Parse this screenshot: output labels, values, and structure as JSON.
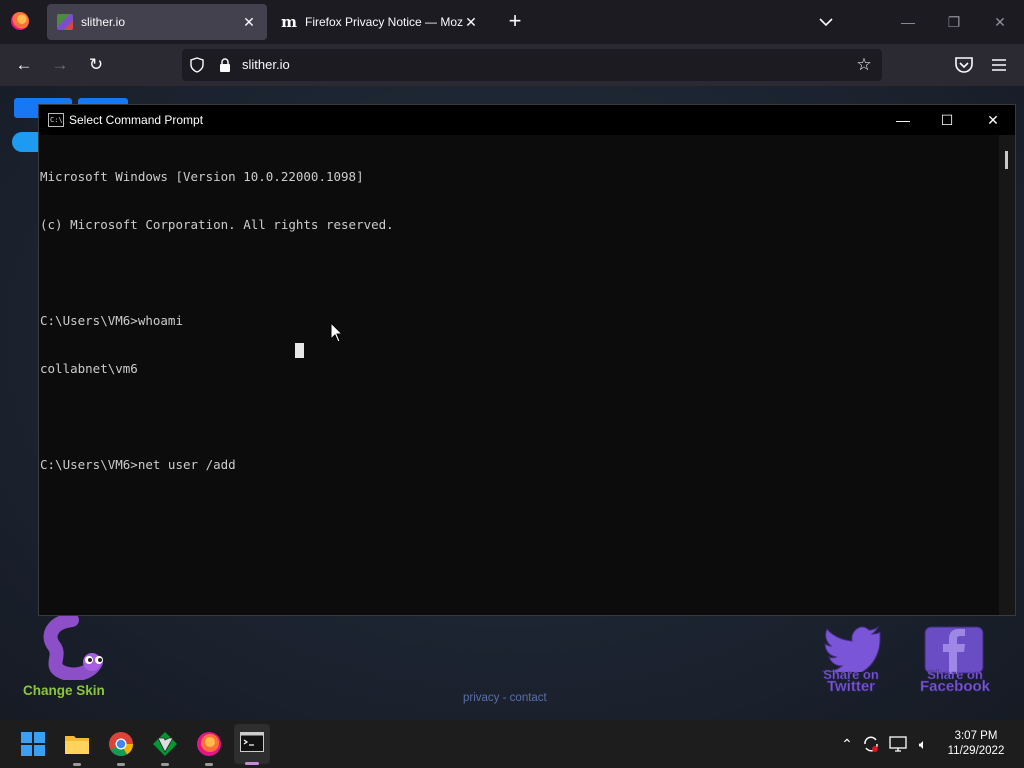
{
  "browser": {
    "tabs": [
      {
        "title": "slither.io",
        "icon": "slither-favicon"
      },
      {
        "title": "Firefox Privacy Notice — Mozill",
        "icon": "mozilla-favicon"
      }
    ],
    "url": "slither.io"
  },
  "cmd": {
    "title": "Select Command Prompt",
    "lines": [
      "Microsoft Windows [Version 10.0.22000.1098]",
      "(c) Microsoft Corporation. All rights reserved.",
      "",
      "C:\\Users\\VM6>whoami",
      "collabnet\\vm6",
      "",
      "C:\\Users\\VM6>net user /add"
    ]
  },
  "page": {
    "change_skin": "Change Skin",
    "footer_privacy": "privacy",
    "footer_sep": " - ",
    "footer_contact": "contact",
    "share_twitter_line1": "Share on",
    "share_twitter_line2": "Twitter",
    "share_facebook_line1": "Share on",
    "share_facebook_line2": "Facebook"
  },
  "taskbar": {
    "time": "3:07 PM",
    "date": "11/29/2022"
  }
}
